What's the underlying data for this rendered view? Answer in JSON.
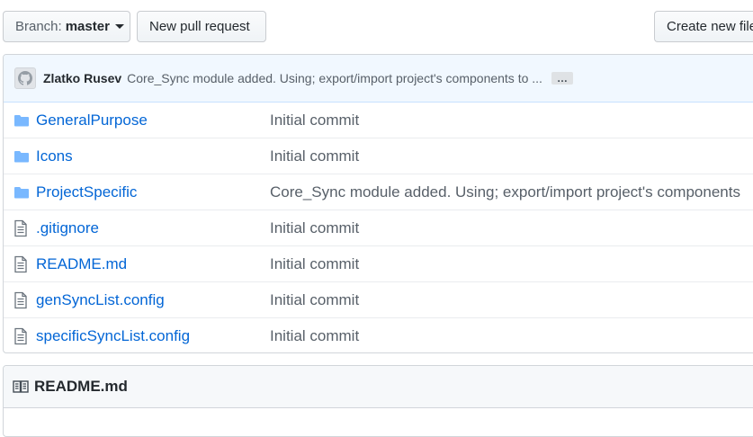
{
  "toolbar": {
    "branch_prefix": "Branch:",
    "branch_name": "master",
    "new_pull_request_label": "New pull request",
    "create_file_label": "Create new file"
  },
  "latest_commit": {
    "author": "Zlatko Rusev",
    "message": "Core_Sync module added. Using; export/import project's components to ...",
    "ellipsis": "…"
  },
  "files": [
    {
      "type": "folder",
      "icon": "folder-icon",
      "name": "GeneralPurpose",
      "commit": "Initial commit"
    },
    {
      "type": "folder",
      "icon": "folder-icon",
      "name": "Icons",
      "commit": "Initial commit"
    },
    {
      "type": "folder",
      "icon": "folder-icon",
      "name": "ProjectSpecific",
      "commit": "Core_Sync module added. Using; export/import project's components"
    },
    {
      "type": "file",
      "icon": "file-icon",
      "name": ".gitignore",
      "commit": "Initial commit"
    },
    {
      "type": "file",
      "icon": "file-icon",
      "name": "README.md",
      "commit": "Initial commit"
    },
    {
      "type": "file",
      "icon": "file-icon",
      "name": "genSyncList.config",
      "commit": "Initial commit"
    },
    {
      "type": "file",
      "icon": "file-icon",
      "name": "specificSyncList.config",
      "commit": "Initial commit"
    }
  ],
  "readme": {
    "title": "README.md",
    "icon": "book-icon"
  },
  "colors": {
    "link": "#0366d6",
    "folder_icon": "#79b8ff",
    "commit_bar_bg": "#f1f8ff"
  }
}
